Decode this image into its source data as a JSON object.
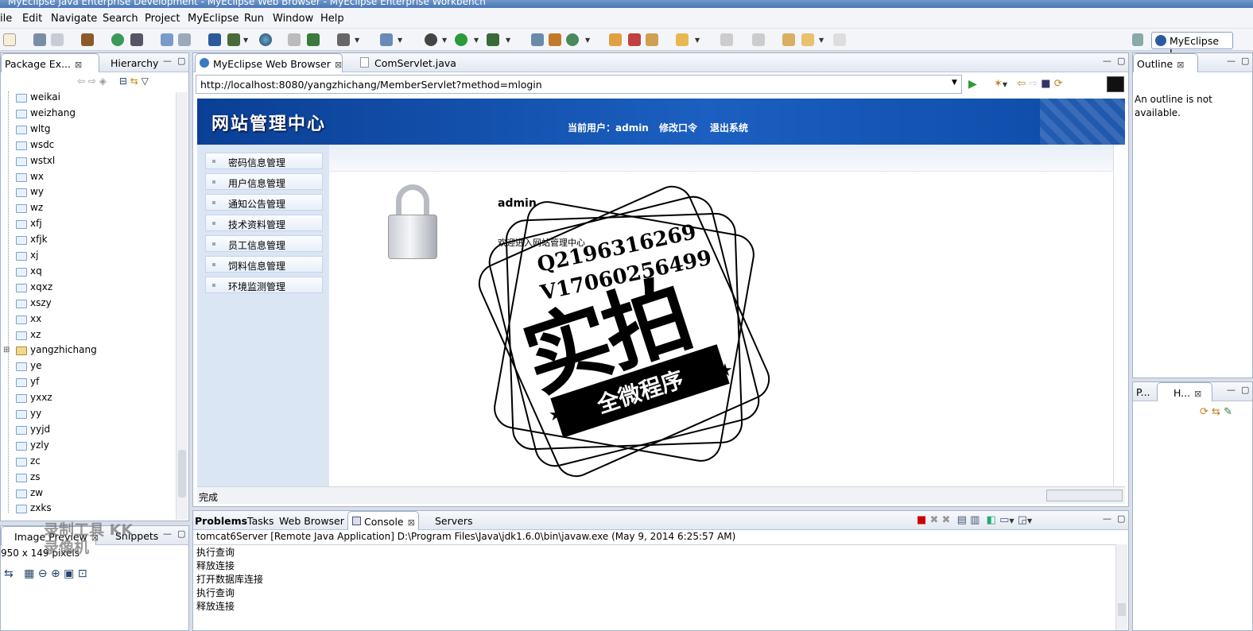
{
  "window": {
    "title": "MyEclipse Java Enterprise Development - MyEclipse Web Browser - MyEclipse Enterprise Workbench"
  },
  "menu": [
    "File",
    "Edit",
    "Navigate",
    "Search",
    "Project",
    "MyEclipse",
    "Run",
    "Window",
    "Help"
  ],
  "menu_display": [
    "ile",
    "Edit",
    "Navigate",
    "Search",
    "Project",
    "MyEclipse",
    "Run",
    "Window",
    "Help"
  ],
  "perspective": {
    "label": "MyEclipse J..."
  },
  "left_panel": {
    "tabs": [
      {
        "label": "Package Ex..."
      },
      {
        "label": "Hierarchy"
      }
    ],
    "tree": [
      "weikai",
      "weizhang",
      "wltg",
      "wsdc",
      "wstxl",
      "wx",
      "wy",
      "wz",
      "xfj",
      "xfjk",
      "xj",
      "xq",
      "xqxz",
      "xszy",
      "xx",
      "xz",
      "yangzhichang",
      "ye",
      "yf",
      "yxxz",
      "yy",
      "yyjd",
      "yzly",
      "zc",
      "zs",
      "zw",
      "zxks"
    ]
  },
  "bottom_left": {
    "tabs": [
      {
        "label": "Image Preview"
      },
      {
        "label": "Snippets"
      }
    ],
    "size_text": "950 x 149 pixels",
    "watermark": "录制工具 KK录像机"
  },
  "editor": {
    "tabs": [
      {
        "label": "MyEclipse Web Browser"
      },
      {
        "label": "ComServlet.java"
      }
    ],
    "url": "http://localhost:8080/yangzhichang/MemberServlet?method=mlogin",
    "status": "完成"
  },
  "site": {
    "title": "网站管理中心",
    "current_user": "当前用户：admin",
    "change_password": "修改口令",
    "logout": "退出系统",
    "nav": [
      "密码信息管理",
      "用户信息管理",
      "通知公告管理",
      "技术资料管理",
      "员工信息管理",
      "饲料信息管理",
      "环境监测管理"
    ],
    "user_name": "admin",
    "welcome": "欢迎进入网站管理中心"
  },
  "outline": {
    "title": "Outline",
    "message": "An outline is not available."
  },
  "right_lower": {
    "tabs": [
      {
        "label": "P..."
      },
      {
        "label": "H..."
      }
    ]
  },
  "console": {
    "tabs": [
      {
        "label": "Problems"
      },
      {
        "label": "Tasks"
      },
      {
        "label": "Web Browser"
      },
      {
        "label": "Console"
      },
      {
        "label": "Servers"
      }
    ],
    "header": "tomcat6Server [Remote Java Application] D:\\Program Files\\Java\\jdk1.6.0\\bin\\javaw.exe (May 9, 2014 6:25:57 AM)",
    "lines": [
      "执行查询",
      "释放连接",
      "打开数据库连接",
      "执行查询",
      "释放连接"
    ]
  },
  "stamp": {
    "qq": "Q2196316269",
    "vx": "V17060256499",
    "main": "实拍",
    "ribbon": "全微程序"
  }
}
